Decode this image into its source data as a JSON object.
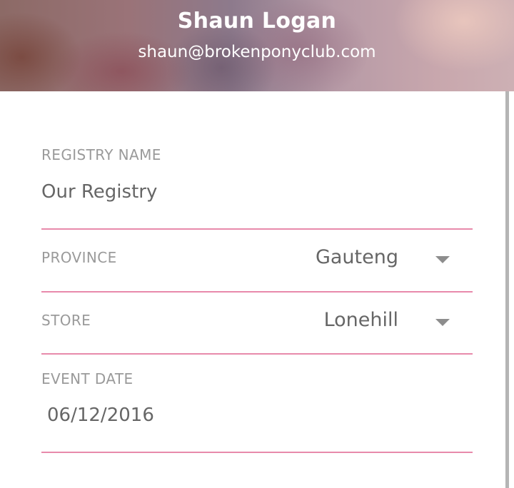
{
  "header": {
    "user_name": "Shaun Logan",
    "user_email": "shaun@brokenponyclub.com"
  },
  "form": {
    "registry_name": {
      "label": "REGISTRY NAME",
      "value": "Our Registry"
    },
    "province": {
      "label": "PROVINCE",
      "selected": "Gauteng",
      "icon": "chevron-down-icon"
    },
    "store": {
      "label": "STORE",
      "selected": "Lonehill",
      "icon": "chevron-down-icon"
    },
    "event_date": {
      "label": "EVENT DATE",
      "value": "06/12/2016"
    }
  },
  "colors": {
    "accent_underline": "#e88aab",
    "label_text": "#9a9a9a",
    "value_text": "#666666"
  }
}
